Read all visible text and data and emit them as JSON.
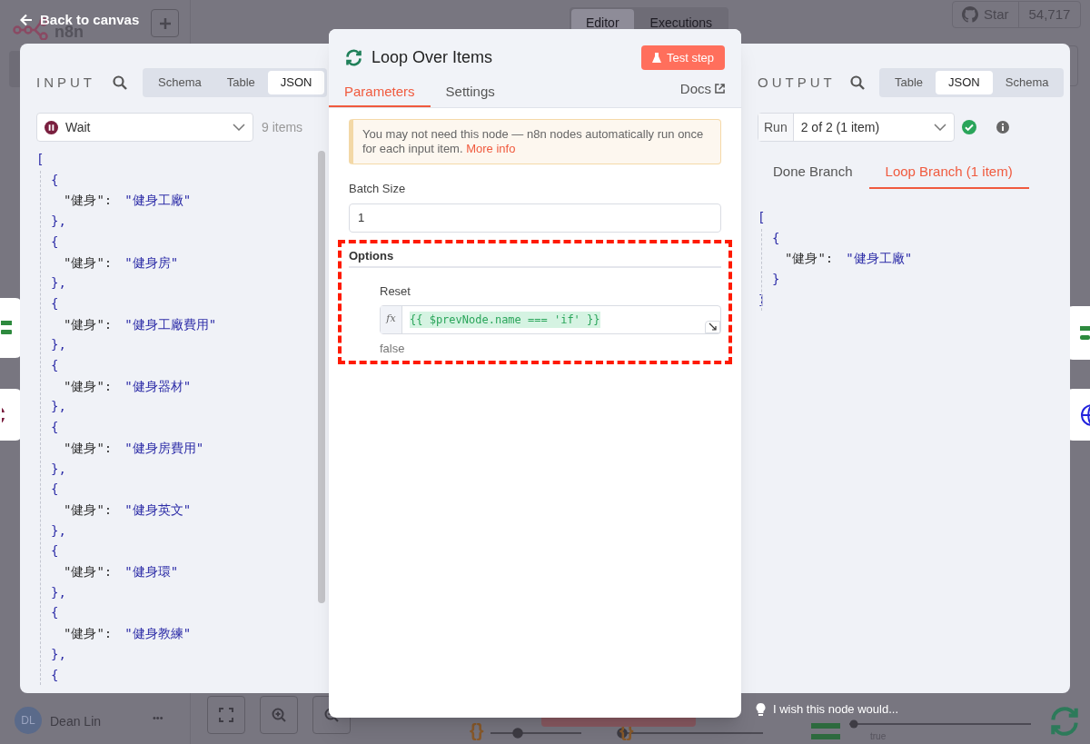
{
  "background": {
    "back_link": "Back to canvas",
    "logo_text": "n8n",
    "top_tabs": [
      {
        "label": "Editor",
        "selected": true
      },
      {
        "label": "Executions",
        "selected": false
      }
    ],
    "star_label": "Star",
    "star_count": "54,717",
    "user_initials": "DL",
    "user_name": "Dean Lin",
    "user_menu": "•••",
    "edge_label": "true",
    "code_node_icons": [
      "{}",
      "{}"
    ]
  },
  "input": {
    "title": "INPUT",
    "views": [
      {
        "label": "Schema",
        "selected": false
      },
      {
        "label": "Table",
        "selected": false
      },
      {
        "label": "JSON",
        "selected": true
      }
    ],
    "source": "Wait",
    "count": "9 items",
    "json": [
      {
        "kind": "bracket",
        "text": "["
      },
      {
        "kind": "brace",
        "text": "{"
      },
      {
        "kind": "pair",
        "key": "\"健身\":",
        "value": "\"健身工廠\""
      },
      {
        "kind": "brace",
        "text": "},"
      },
      {
        "kind": "brace",
        "text": "{"
      },
      {
        "kind": "pair",
        "key": "\"健身\":",
        "value": "\"健身房\""
      },
      {
        "kind": "brace",
        "text": "},"
      },
      {
        "kind": "brace",
        "text": "{"
      },
      {
        "kind": "pair",
        "key": "\"健身\":",
        "value": "\"健身工廠費用\""
      },
      {
        "kind": "brace",
        "text": "},"
      },
      {
        "kind": "brace",
        "text": "{"
      },
      {
        "kind": "pair",
        "key": "\"健身\":",
        "value": "\"健身器材\""
      },
      {
        "kind": "brace",
        "text": "},"
      },
      {
        "kind": "brace",
        "text": "{"
      },
      {
        "kind": "pair",
        "key": "\"健身\":",
        "value": "\"健身房費用\""
      },
      {
        "kind": "brace",
        "text": "},"
      },
      {
        "kind": "brace",
        "text": "{"
      },
      {
        "kind": "pair",
        "key": "\"健身\":",
        "value": "\"健身英文\""
      },
      {
        "kind": "brace",
        "text": "},"
      },
      {
        "kind": "brace",
        "text": "{"
      },
      {
        "kind": "pair",
        "key": "\"健身\":",
        "value": "\"健身環\""
      },
      {
        "kind": "brace",
        "text": "},"
      },
      {
        "kind": "brace",
        "text": "{"
      },
      {
        "kind": "pair",
        "key": "\"健身\":",
        "value": "\"健身教練\""
      },
      {
        "kind": "brace",
        "text": "},"
      },
      {
        "kind": "brace",
        "text": "{"
      }
    ]
  },
  "node": {
    "title": "Loop Over Items",
    "test_button": "Test step",
    "tabs": [
      {
        "label": "Parameters",
        "selected": true
      },
      {
        "label": "Settings",
        "selected": false
      }
    ],
    "docs": "Docs",
    "notice": "You may not need this node — n8n nodes automatically run once for each input item.",
    "notice_link": "More info",
    "batch_label": "Batch Size",
    "batch_value": "1",
    "options_label": "Options",
    "reset_label": "Reset",
    "fx": "fx",
    "expression": "{{ $prevNode.name === 'if' }}",
    "expression_result": "false"
  },
  "output": {
    "title": "OUTPUT",
    "views": [
      {
        "label": "Table",
        "selected": false
      },
      {
        "label": "JSON",
        "selected": true
      },
      {
        "label": "Schema",
        "selected": false
      }
    ],
    "run_label": "Run",
    "run_value": "2 of 2 (1 item)",
    "branches": [
      {
        "label": "Done Branch",
        "selected": false
      },
      {
        "label": "Loop Branch (1 item)",
        "selected": true
      }
    ],
    "json": [
      {
        "kind": "bracket",
        "text": "["
      },
      {
        "kind": "brace",
        "text": "{"
      },
      {
        "kind": "pair",
        "key": "\"健身\":",
        "value": "\"健身工廠\""
      },
      {
        "kind": "brace",
        "text": "}"
      },
      {
        "kind": "bracket",
        "text": "]"
      }
    ]
  },
  "hint": "I wish this node would..."
}
